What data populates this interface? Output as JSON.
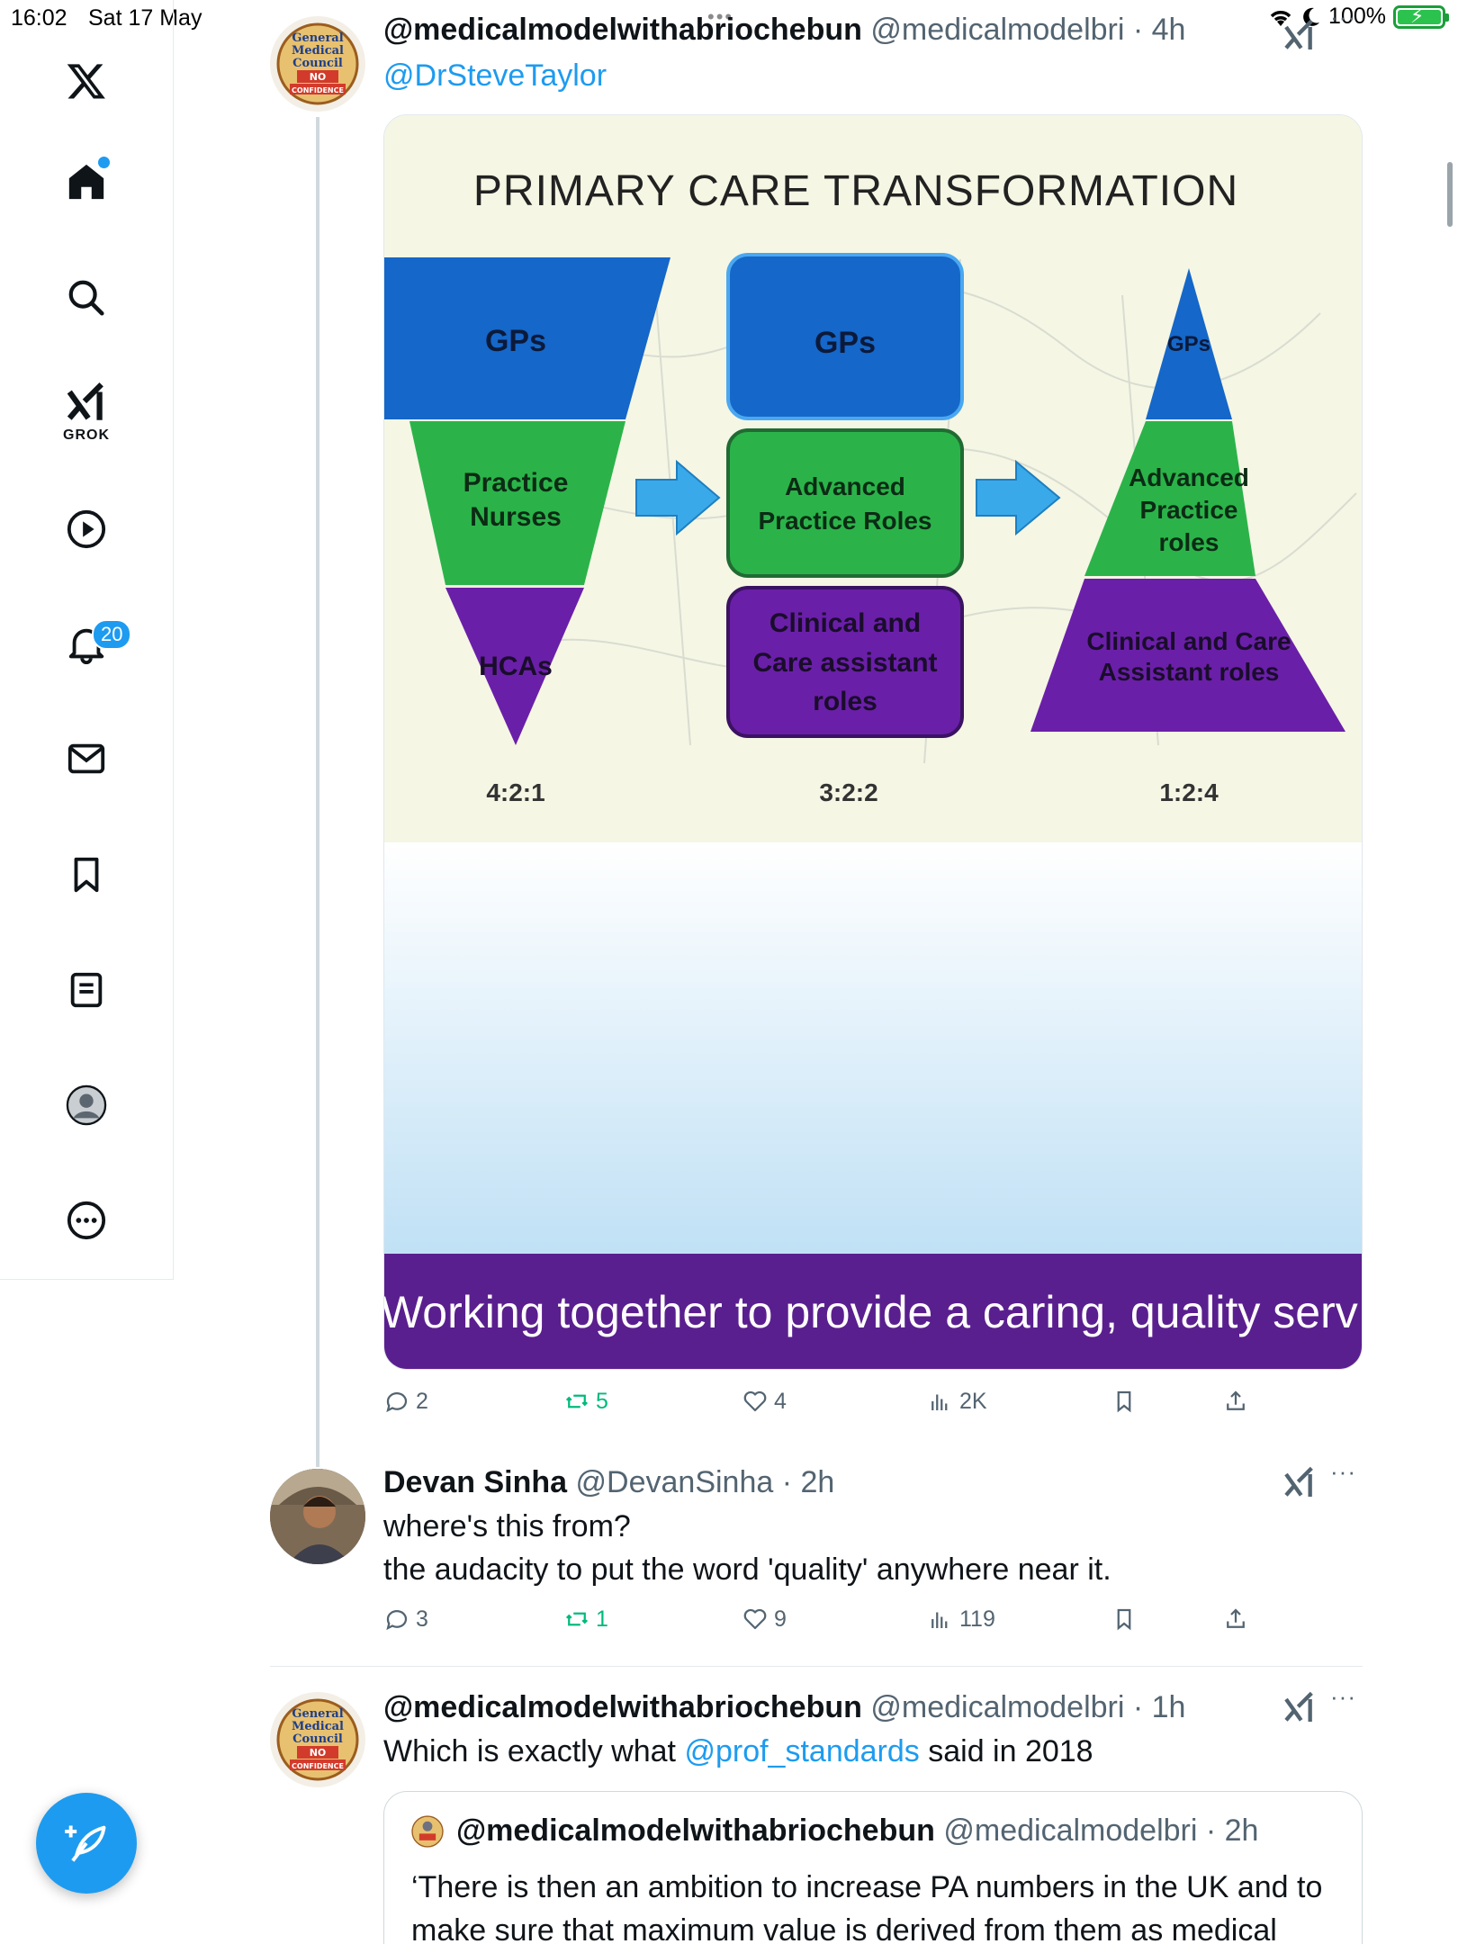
{
  "status_bar": {
    "time": "16:02",
    "date": "Sat 17 May",
    "battery": "100%"
  },
  "sidebar": {
    "grok_label": "GROK",
    "notifications_count": "20"
  },
  "tweets": [
    {
      "name": "@medicalmodelwithabriochebun",
      "handle": "@medicalmodelbri",
      "time": "4h",
      "text": "@DrSteveTaylor",
      "image": {
        "title": "PRIMARY CARE TRANSFORMATION",
        "left": {
          "top": "GPs",
          "middle_line1": "Practice",
          "middle_line2": "Nurses",
          "bottom": "HCAs",
          "ratio": "4:2:1"
        },
        "center": {
          "top": "GPs",
          "middle_line1": "Advanced",
          "middle_line2": "Practice Roles",
          "bottom_line1": "Clinical and",
          "bottom_line2": "Care assistant",
          "bottom_line3": "roles",
          "ratio": "3:2:2"
        },
        "right": {
          "top": "GPs",
          "middle_line1": "Advanced",
          "middle_line2": "Practice",
          "middle_line3": "roles",
          "bottom_line1": "Clinical and Care",
          "bottom_line2": "Assistant roles",
          "ratio": "1:2:4"
        },
        "footer": "Working together to provide a caring, quality serv"
      },
      "stats": {
        "replies": "2",
        "reposts": "5",
        "likes": "4",
        "views": "2K"
      }
    },
    {
      "name": "Devan Sinha",
      "handle": "@DevanSinha",
      "time": "2h",
      "text_line1": "where's this from?",
      "text_line2": "the audacity to put the word 'quality' anywhere near it.",
      "stats": {
        "replies": "3",
        "reposts": "1",
        "likes": "9",
        "views": "119"
      }
    },
    {
      "name": "@medicalmodelwithabriochebun",
      "handle": "@medicalmodelbri",
      "time": "1h",
      "text_before": "Which is exactly what ",
      "text_mention": "@prof_standards",
      "text_after": " said in 2018",
      "quote": {
        "name": "@medicalmodelwithabriochebun",
        "handle": "@medicalmodelbri",
        "time": "2h",
        "text": "‘There is then an ambition to increase PA numbers in the UK and to make sure that maximum value is derived from them as medical"
      }
    }
  ],
  "avatar_text": {
    "line1": "General",
    "line2": "Medical",
    "line3": "Council",
    "line4": "NO",
    "line5": "CONFIDENCE"
  },
  "colors": {
    "accent": "#1d9bf0",
    "repost": "#00ba7c",
    "blue_tier": "#1567c9",
    "green_tier": "#2bb34a",
    "purple_tier": "#6a1fa8",
    "arrow": "#3aa9ea"
  }
}
